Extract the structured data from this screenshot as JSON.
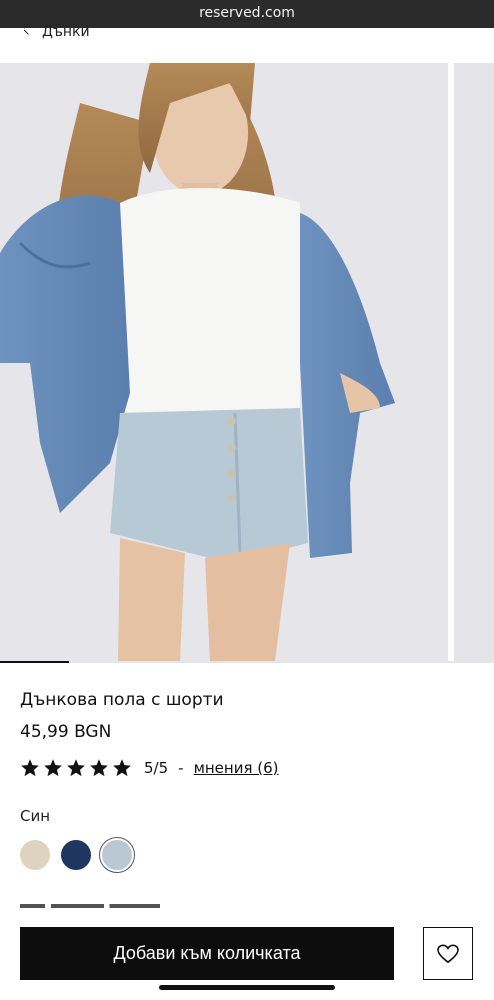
{
  "browser": {
    "url": "reserved.com"
  },
  "breadcrumb": {
    "label": "Дънки"
  },
  "gallery": {
    "image_count_shown": 1,
    "progress": 0.14
  },
  "product": {
    "title": "Дънкова пола с шорти",
    "price": "45,99 BGN",
    "rating": {
      "stars": 5,
      "score": "5/5",
      "separator": "-",
      "reviews_label": "мнения (6)"
    },
    "color_label": "Син",
    "swatches": [
      {
        "name": "beige",
        "color": "#ddd3bf"
      },
      {
        "name": "navy",
        "color": "#1f3660"
      },
      {
        "name": "light-blue",
        "color": "#b9c8d2",
        "selected": true
      }
    ]
  },
  "actions": {
    "add_to_cart": "Добави към количката"
  },
  "colors": {
    "accent": "#0d0d0d",
    "star": "#111111"
  }
}
